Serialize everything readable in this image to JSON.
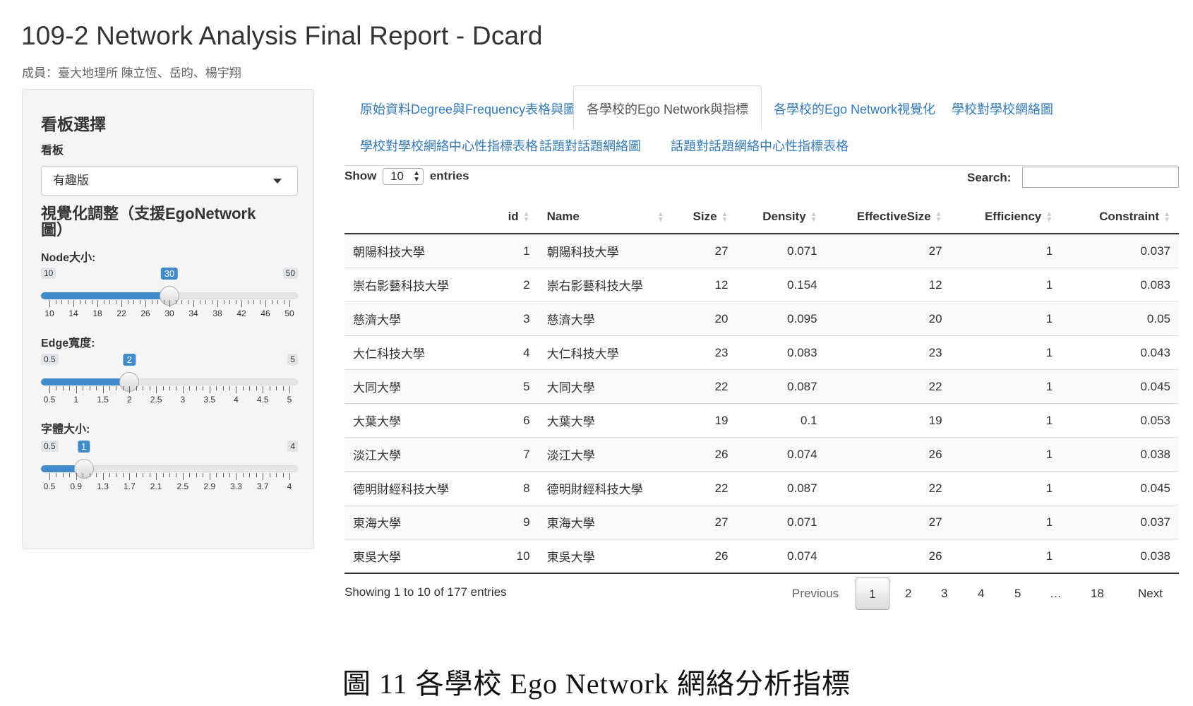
{
  "page": {
    "title": "109-2 Network Analysis Final Report - Dcard",
    "members": "成員：臺大地理所 陳立恆、岳昀、楊宇翔",
    "caption": "圖  11  各學校 Ego Network 網絡分析指標"
  },
  "sidebar": {
    "heading": "看板選擇",
    "board_label": "看板",
    "board_value": "有趣版",
    "vis_heading": "視覺化調整（支援EgoNetwork圖）",
    "sliders": [
      {
        "label": "Node大小:",
        "min": "10",
        "max": "50",
        "value": "30",
        "fraction": 0.5,
        "ticks": [
          "10",
          "14",
          "18",
          "22",
          "26",
          "30",
          "34",
          "38",
          "42",
          "46",
          "50"
        ]
      },
      {
        "label": "Edge寬度:",
        "min": "0.5",
        "max": "5",
        "value": "2",
        "fraction": 0.3333,
        "ticks": [
          "0.5",
          "1",
          "1.5",
          "2",
          "2.5",
          "3",
          "3.5",
          "4",
          "4.5",
          "5"
        ]
      },
      {
        "label": "字體大小:",
        "min": "0.5",
        "max": "4",
        "value": "1",
        "fraction": 0.1429,
        "ticks": [
          "0.5",
          "0.9",
          "1.3",
          "1.7",
          "2.1",
          "2.5",
          "2.9",
          "3.3",
          "3.7",
          "4"
        ]
      }
    ]
  },
  "tabs": [
    "原始資料Degree與Frequency表格與圖形",
    "各學校的Ego Network與指標",
    "各學校的Ego Network視覺化",
    "學校對學校網絡圖",
    "學校對學校網絡中心性指標表格",
    "話題對話題網絡圖",
    "話題對話題網絡中心性指標表格"
  ],
  "controls": {
    "show": "Show",
    "length": "10",
    "entries": "entries",
    "search": "Search:"
  },
  "table": {
    "columns": [
      "",
      "id",
      "Name",
      "Size",
      "Density",
      "EffectiveSize",
      "Efficiency",
      "Constraint"
    ],
    "rows": [
      [
        "朝陽科技大學",
        "1",
        "朝陽科技大學",
        "27",
        "0.071",
        "27",
        "1",
        "0.037"
      ],
      [
        "崇右影藝科技大學",
        "2",
        "崇右影藝科技大學",
        "12",
        "0.154",
        "12",
        "1",
        "0.083"
      ],
      [
        "慈濟大學",
        "3",
        "慈濟大學",
        "20",
        "0.095",
        "20",
        "1",
        "0.05"
      ],
      [
        "大仁科技大學",
        "4",
        "大仁科技大學",
        "23",
        "0.083",
        "23",
        "1",
        "0.043"
      ],
      [
        "大同大學",
        "5",
        "大同大學",
        "22",
        "0.087",
        "22",
        "1",
        "0.045"
      ],
      [
        "大葉大學",
        "6",
        "大葉大學",
        "19",
        "0.1",
        "19",
        "1",
        "0.053"
      ],
      [
        "淡江大學",
        "7",
        "淡江大學",
        "26",
        "0.074",
        "26",
        "1",
        "0.038"
      ],
      [
        "德明財經科技大學",
        "8",
        "德明財經科技大學",
        "22",
        "0.087",
        "22",
        "1",
        "0.045"
      ],
      [
        "東海大學",
        "9",
        "東海大學",
        "27",
        "0.071",
        "27",
        "1",
        "0.037"
      ],
      [
        "東吳大學",
        "10",
        "東吳大學",
        "26",
        "0.074",
        "26",
        "1",
        "0.038"
      ]
    ]
  },
  "footer": {
    "info": "Showing 1 to 10 of 177 entries",
    "previous": "Previous",
    "pages": [
      "1",
      "2",
      "3",
      "4",
      "5",
      "…",
      "18"
    ],
    "next": "Next"
  }
}
